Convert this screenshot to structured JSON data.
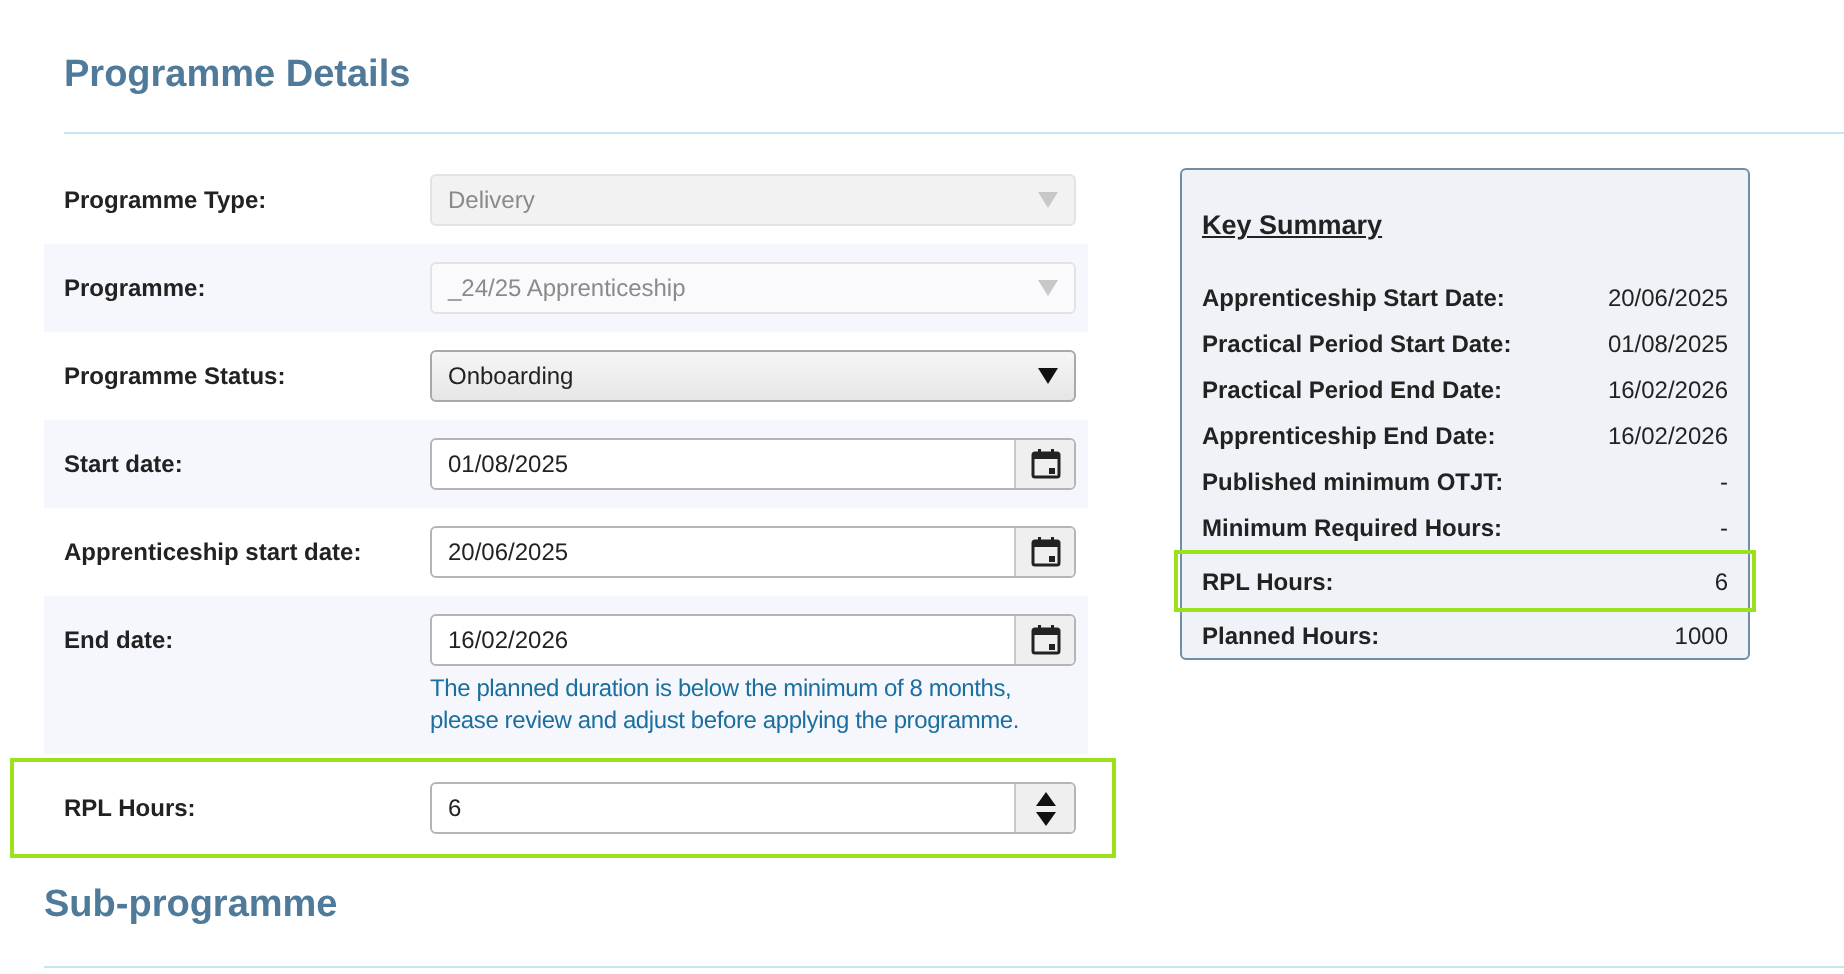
{
  "heading": "Programme Details",
  "fields": [
    {
      "label": "Programme Type:",
      "kind": "select",
      "value": "Delivery",
      "disabled": true,
      "highlighted": false
    },
    {
      "label": "Programme:",
      "kind": "select",
      "value": "_24/25 Apprenticeship",
      "disabled": true,
      "highlighted": false
    },
    {
      "label": "Programme Status:",
      "kind": "select",
      "value": "Onboarding",
      "disabled": false,
      "highlighted": false
    },
    {
      "label": "Start date:",
      "kind": "date",
      "value": "01/08/2025",
      "disabled": false,
      "highlighted": false
    },
    {
      "label": "Apprenticeship start date:",
      "kind": "date",
      "value": "20/06/2025",
      "disabled": false,
      "highlighted": false
    },
    {
      "label": "End date:",
      "kind": "date",
      "value": "16/02/2026",
      "disabled": false,
      "highlighted": false,
      "message": "The planned duration is below the minimum of 8 months, please review and adjust before applying the programme."
    },
    {
      "label": "RPL Hours:",
      "kind": "number",
      "value": "6",
      "disabled": false,
      "highlighted": true
    }
  ],
  "summary": {
    "title": "Key Summary",
    "rows": [
      {
        "label": "Apprenticeship Start Date:",
        "value": "20/06/2025",
        "highlighted": false
      },
      {
        "label": "Practical Period Start Date:",
        "value": "01/08/2025",
        "highlighted": false
      },
      {
        "label": "Practical Period End Date:",
        "value": "16/02/2026",
        "highlighted": false
      },
      {
        "label": "Apprenticeship End Date:",
        "value": "16/02/2026",
        "highlighted": false
      },
      {
        "label": "Published minimum OTJT:",
        "value": "-",
        "highlighted": false
      },
      {
        "label": "Minimum Required Hours:",
        "value": "-",
        "highlighted": false
      },
      {
        "label": "RPL Hours:",
        "value": "6",
        "highlighted": true
      },
      {
        "label": "Planned Hours:",
        "value": "1000",
        "highlighted": false
      }
    ]
  },
  "sub_heading": "Sub-programme"
}
